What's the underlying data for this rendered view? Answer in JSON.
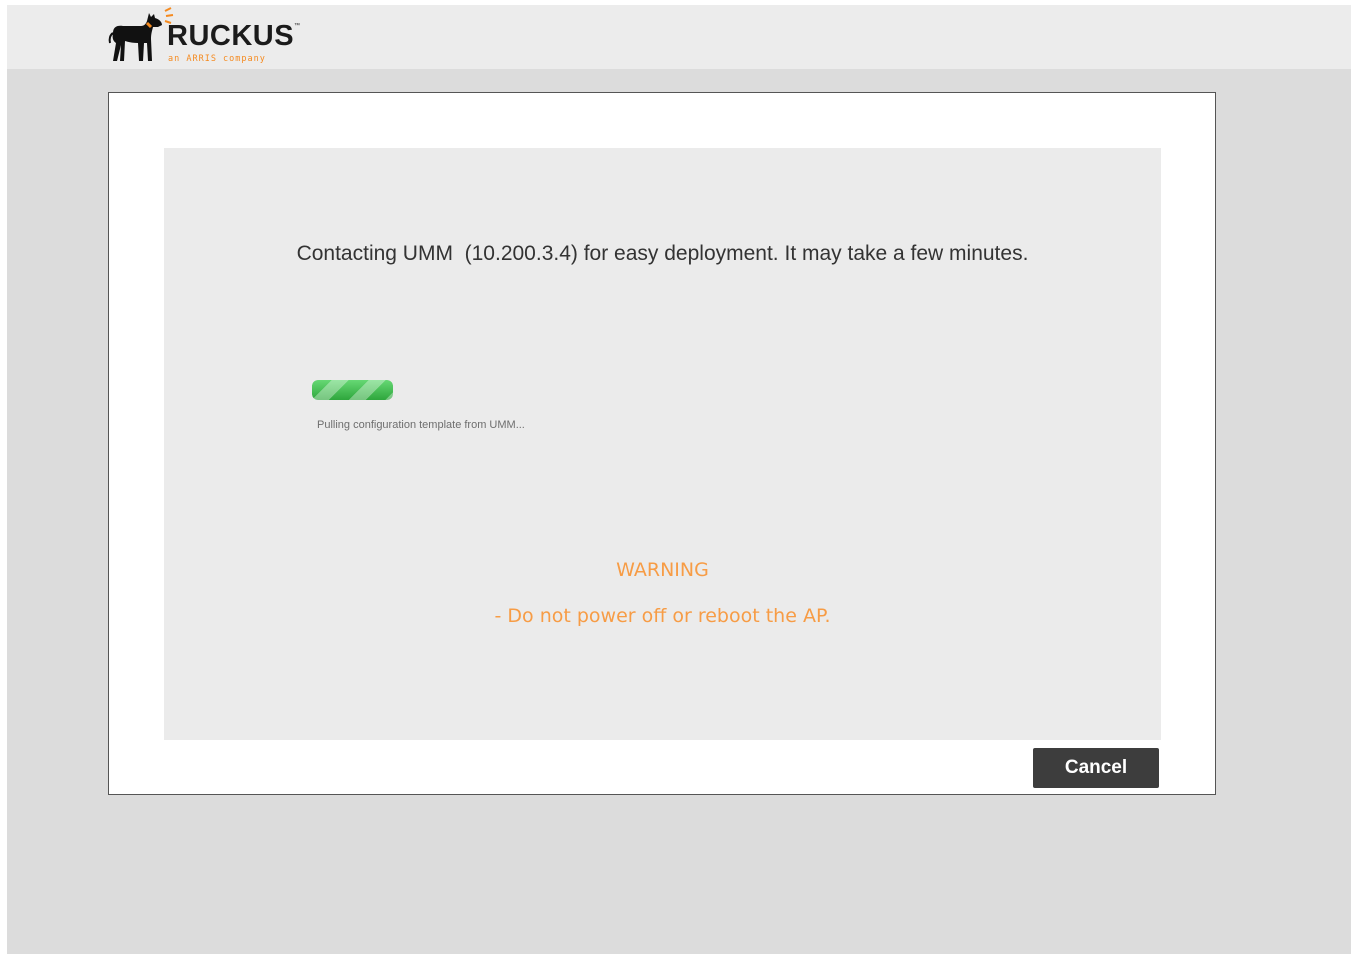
{
  "header": {
    "logo_text": "RUCKUS",
    "logo_trademark": "™",
    "logo_subtitle": "an ARRIS company"
  },
  "dialog": {
    "message": "Contacting UMM  (10.200.3.4) for easy deployment. It may take a few minutes.",
    "progress": {
      "percent": 100,
      "status_text": "Pulling configuration template from UMM..."
    },
    "warning": {
      "title": "WARNING",
      "text": "- Do not power off or reboot the AP."
    },
    "cancel_label": "Cancel"
  },
  "colors": {
    "accent_orange": "#f79c45",
    "progress_green": "#3fc24f",
    "button_dark": "#3d3d3d"
  }
}
